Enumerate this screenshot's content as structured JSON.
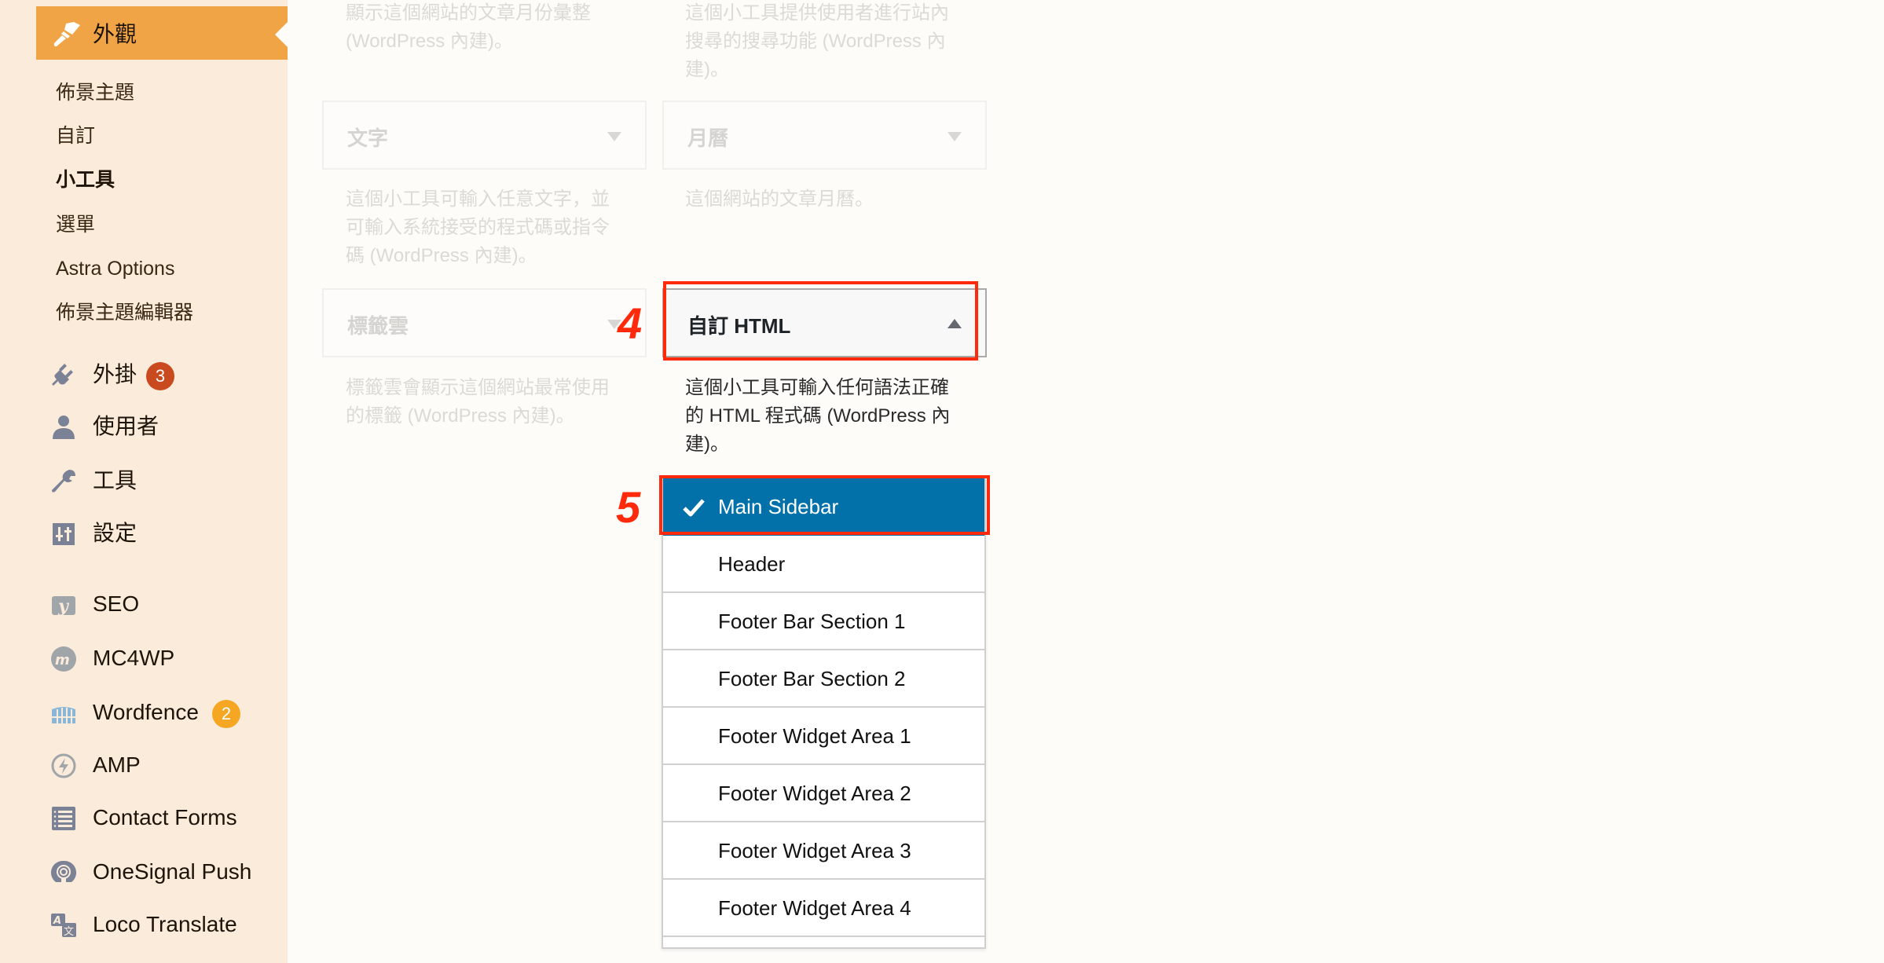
{
  "sidebar": {
    "active_menu": {
      "label": "外觀",
      "icon": "paintbrush-icon"
    },
    "submenu": [
      {
        "label": "佈景主題",
        "current": false
      },
      {
        "label": "自訂",
        "current": false
      },
      {
        "label": "小工具",
        "current": true
      },
      {
        "label": "選單",
        "current": false
      },
      {
        "label": "Astra Options",
        "current": false
      },
      {
        "label": "佈景主題編輯器",
        "current": false
      }
    ],
    "menu": [
      {
        "label": "外掛",
        "icon": "plugin-icon",
        "badge": "3",
        "badge_color": "#ca4a1f"
      },
      {
        "label": "使用者",
        "icon": "user-icon"
      },
      {
        "label": "工具",
        "icon": "wrench-icon"
      },
      {
        "label": "設定",
        "icon": "settings-icon"
      },
      {
        "label": "SEO",
        "icon": "yoast-icon"
      },
      {
        "label": "MC4WP",
        "icon": "mc4wp-icon"
      },
      {
        "label": "Wordfence",
        "icon": "wordfence-icon",
        "badge": "2",
        "badge_color": "#f5a623"
      },
      {
        "label": "AMP",
        "icon": "amp-icon"
      },
      {
        "label": "Contact Forms",
        "icon": "form-list-icon"
      },
      {
        "label": "OneSignal Push",
        "icon": "onesignal-icon"
      },
      {
        "label": "Loco Translate",
        "icon": "translate-icon"
      }
    ]
  },
  "widgets": {
    "archives_desc": "顯示這個網站的文章月份彙整 (WordPress 內建)。",
    "search_desc": "這個小工具提供使用者進行站內搜尋的搜尋功能 (WordPress 內建)。",
    "text": {
      "title": "文字",
      "desc": "這個小工具可輸入任意文字，並可輸入系統接受的程式碼或指令碼 (WordPress 內建)。"
    },
    "calendar": {
      "title": "月曆",
      "desc": "這個網站的文章月曆。"
    },
    "tag_cloud": {
      "title": "標籤雲",
      "desc": "標籤雲會顯示這個網站最常使用的標籤 (WordPress 內建)。"
    },
    "custom_html": {
      "title": "自訂 HTML",
      "desc": "這個小工具可輸入任何語法正確的 HTML 程式碼 (WordPress 內建)。"
    }
  },
  "sidebar_chooser": {
    "options": [
      {
        "label": "Main Sidebar",
        "selected": true
      },
      {
        "label": "Header",
        "selected": false
      },
      {
        "label": "Footer Bar Section 1",
        "selected": false
      },
      {
        "label": "Footer Bar Section 2",
        "selected": false
      },
      {
        "label": "Footer Widget Area 1",
        "selected": false
      },
      {
        "label": "Footer Widget Area 2",
        "selected": false
      },
      {
        "label": "Footer Widget Area 3",
        "selected": false
      },
      {
        "label": "Footer Widget Area 4",
        "selected": false
      }
    ]
  },
  "annotations": {
    "step4": "4",
    "step5": "5",
    "color": "#ff2a0c"
  },
  "colors": {
    "accent": "#f0a446",
    "selected": "#0271a9",
    "sidebar_bg": "#fbebdb"
  }
}
